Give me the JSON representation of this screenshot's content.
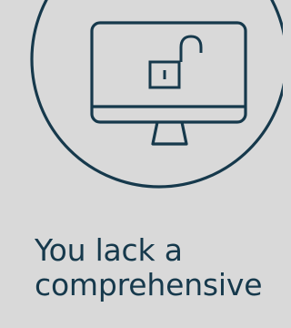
{
  "colors": {
    "background": "#d9d9d9",
    "ink": "#16394c"
  },
  "icons": {
    "main": "unlocked-computer-icon",
    "badge": "open-padlock-icon"
  },
  "caption": {
    "line1": "You lack a",
    "line2": "comprehensive"
  }
}
